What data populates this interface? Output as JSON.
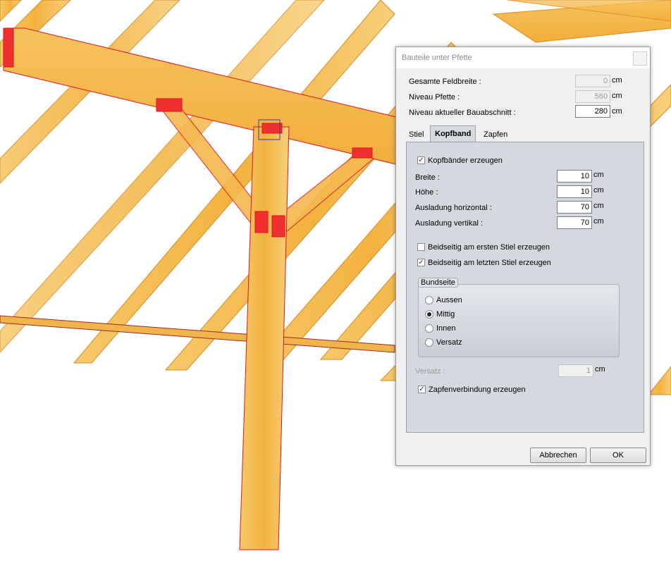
{
  "dialog": {
    "title": "Bauteile unter Pfette",
    "fields": {
      "feldbreite": {
        "label": "Gesamte Feldbreite :",
        "value": "0",
        "unit": "cm"
      },
      "niveau_pfette": {
        "label": "Niveau Pfette :",
        "value": "560",
        "unit": "cm"
      },
      "niveau_bauabschnitt": {
        "label": "Niveau aktueller Bauabschnitt :",
        "value": "280",
        "unit": "cm"
      }
    },
    "tabs": [
      "Stiel",
      "Kopfband",
      "Zapfen"
    ],
    "active_tab": "Kopfband",
    "kopfband": {
      "erzeugen": {
        "label": "Kopfbänder erzeugen",
        "checked": true
      },
      "breite": {
        "label": "Breite :",
        "value": "10",
        "unit": "cm"
      },
      "hoehe": {
        "label": "Höhe :",
        "value": "10",
        "unit": "cm"
      },
      "ausladung_h": {
        "label": "Ausladung horizontal :",
        "value": "70",
        "unit": "cm"
      },
      "ausladung_v": {
        "label": "Ausladung vertikal :",
        "value": "70",
        "unit": "cm"
      },
      "beidseitig_erster": {
        "label": "Beidseitig am ersten Stiel erzeugen",
        "checked": false
      },
      "beidseitig_letzter": {
        "label": "Beidseitig am letzten Stiel erzeugen",
        "checked": true
      },
      "bundseite": {
        "caption": "Bundseite",
        "options": [
          "Aussen",
          "Mittig",
          "Innen",
          "Versatz"
        ],
        "selected": "Mittig"
      },
      "versatz": {
        "label": "Versatz :",
        "value": "1",
        "unit": "cm"
      },
      "zapfenverbindung": {
        "label": "Zapfenverbindung erzeugen",
        "checked": true
      }
    },
    "buttons": {
      "cancel": "Abbrechen",
      "ok": "OK"
    }
  },
  "colors": {
    "timber": "#f2b347",
    "cut_outline": "#e0141e",
    "selection": "#3a3aa8"
  }
}
